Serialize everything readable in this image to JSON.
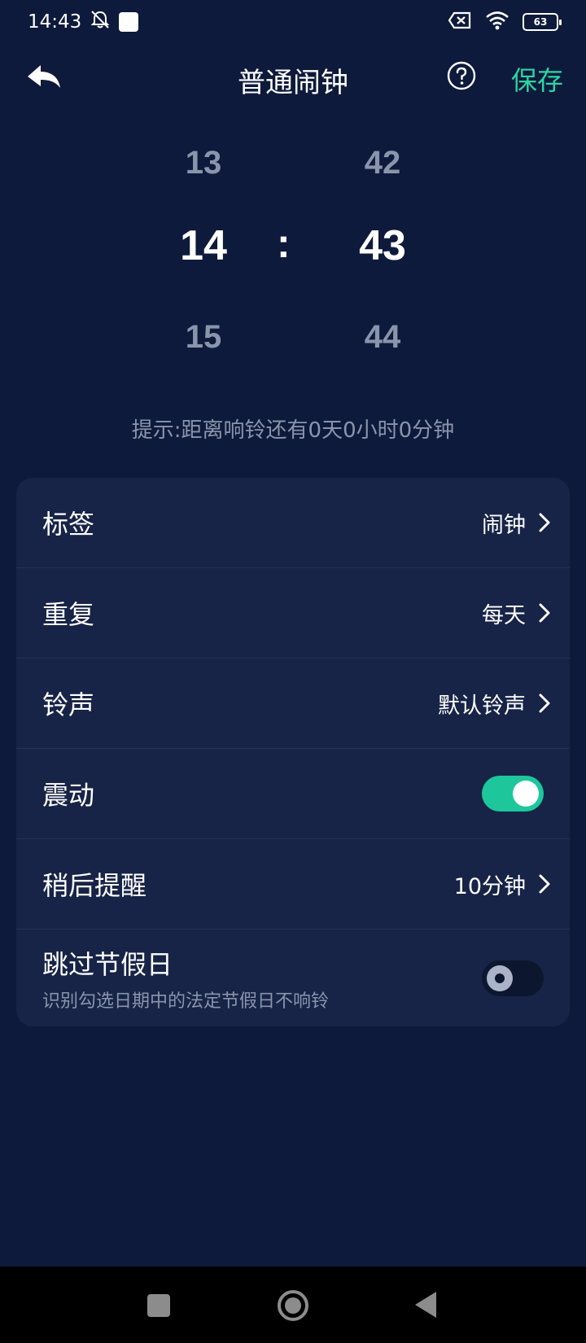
{
  "status_bar": {
    "time": "14:43",
    "battery": "63",
    "icons": [
      "mute-notifications-icon",
      "app-notification-icon",
      "sim-disabled-icon",
      "wifi-icon",
      "battery-icon"
    ]
  },
  "header": {
    "title": "普通闹钟",
    "save_label": "保存",
    "icons": [
      "back-icon",
      "help-icon"
    ]
  },
  "picker": {
    "hours": {
      "prev": "13",
      "current": "14",
      "next": "15"
    },
    "minutes": {
      "prev": "42",
      "current": "43",
      "next": "44"
    },
    "separator": ":"
  },
  "hint": "提示:距离响铃还有0天0小时0分钟",
  "settings": {
    "label": {
      "title": "标签",
      "value": "闹钟"
    },
    "repeat": {
      "title": "重复",
      "value": "每天"
    },
    "ringtone": {
      "title": "铃声",
      "value": "默认铃声"
    },
    "vibrate": {
      "title": "震动",
      "enabled": true
    },
    "snooze": {
      "title": "稍后提醒",
      "value": "10分钟"
    },
    "skip_holidays": {
      "title": "跳过节假日",
      "subtitle": "识别勾选日期中的法定节假日不响铃",
      "enabled": false
    }
  },
  "colors": {
    "background": "#0e1a3b",
    "card": "#172447",
    "accent": "#2dd4a4",
    "toggle_on": "#1dc79b"
  }
}
